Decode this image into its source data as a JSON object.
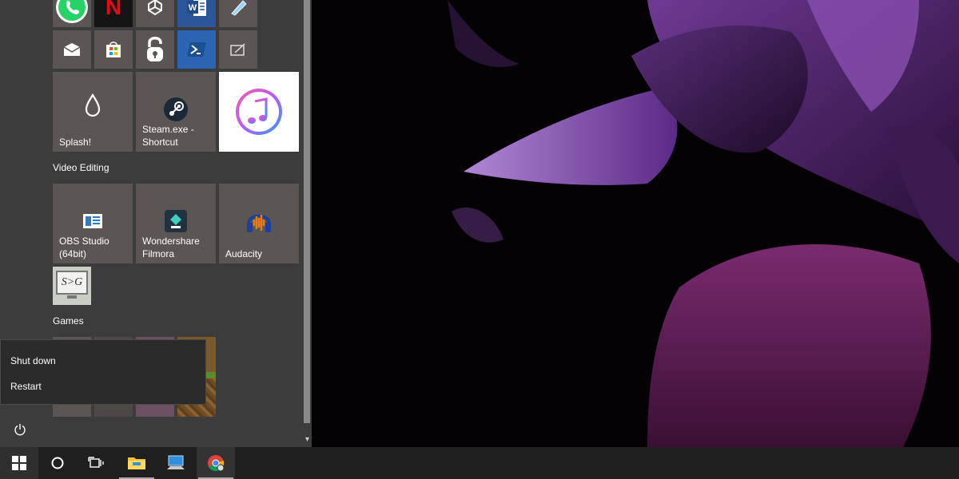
{
  "tiles": {
    "row_top": [
      {
        "icon": "whatsapp-icon",
        "color": "#5b5653"
      },
      {
        "icon": "netflix-icon",
        "color": "#141414"
      },
      {
        "icon": "unity-icon",
        "color": "#5b5653"
      },
      {
        "icon": "word-icon",
        "color": "#2b579a"
      },
      {
        "icon": "ruler-icon",
        "color": "#5b5653"
      }
    ],
    "row_two": [
      {
        "icon": "mail-icon",
        "color": "#5b5653"
      },
      {
        "icon": "store-icon",
        "color": "#5b5653"
      },
      {
        "icon": "lock-icon",
        "color": "#5b5653"
      },
      {
        "icon": "powershell-icon",
        "color": "#2a64b2"
      },
      {
        "icon": "snipping-icon",
        "color": "#5b5653"
      }
    ],
    "splash": {
      "label": "Splash!",
      "icon": "droplet-icon"
    },
    "steam": {
      "label": "Steam.exe -\nShortcut",
      "icon": "steam-icon"
    },
    "itunes": {
      "icon": "itunes-icon",
      "color": "#ffffff"
    }
  },
  "groups": {
    "video_editing": {
      "title": "Video Editing",
      "tiles": [
        {
          "label": "OBS Studio\n(64bit)",
          "icon": "obs-icon"
        },
        {
          "label": "Wondershare\nFilmora",
          "icon": "filmora-icon"
        },
        {
          "label": "Audacity",
          "icon": "audacity-icon"
        }
      ],
      "small_tile": {
        "icon": "s-g-icon",
        "text": "S>G"
      }
    },
    "games": {
      "title": "Games"
    }
  },
  "power_menu": {
    "items": [
      "Shut down",
      "Restart"
    ]
  },
  "taskbar": {
    "items": [
      "windows-start-icon",
      "cortana-icon",
      "task-view-icon",
      "file-explorer-icon",
      "this-pc-icon",
      "chrome-icon"
    ]
  },
  "colors": {
    "start_bg": "#3c3c3c",
    "tile_bg": "#5b5653",
    "taskbar_bg": "#1f1f1f",
    "accent_word": "#2b579a"
  }
}
